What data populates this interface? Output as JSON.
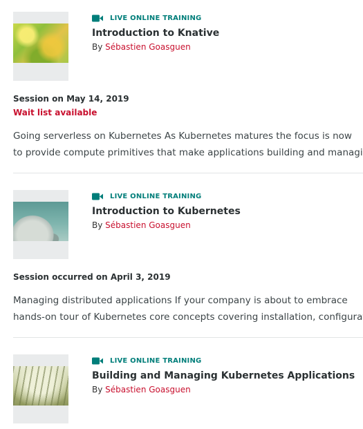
{
  "items": [
    {
      "type_label": "LIVE ONLINE TRAINING",
      "title": "Introduction to Knative",
      "by_label": "By",
      "author": "Sébastien Goasguen",
      "session": "Session on May 14, 2019",
      "waitlist": "Wait list available",
      "desc_line1": "Going serverless on Kubernetes As Kubernetes matures the focus is now",
      "desc_line2": "to provide compute primitives that make applications building and managing"
    },
    {
      "type_label": "LIVE ONLINE TRAINING",
      "title": "Introduction to Kubernetes",
      "by_label": "By",
      "author": "Sébastien Goasguen",
      "session": "Session occurred on April 3, 2019",
      "desc_line1": "Managing distributed applications If your company is about to embrace",
      "desc_line2": "hands-on tour of Kubernetes core concepts covering installation, configuration"
    },
    {
      "type_label": "LIVE ONLINE TRAINING",
      "title": "Building and Managing Kubernetes Applications",
      "by_label": "By",
      "author": "Sébastien Goasguen"
    }
  ],
  "colors": {
    "accent_teal": "#007e7a",
    "link_red": "#c8102e",
    "divider": "#e2e4e5"
  },
  "icons": {
    "type": "video-camera-icon"
  }
}
